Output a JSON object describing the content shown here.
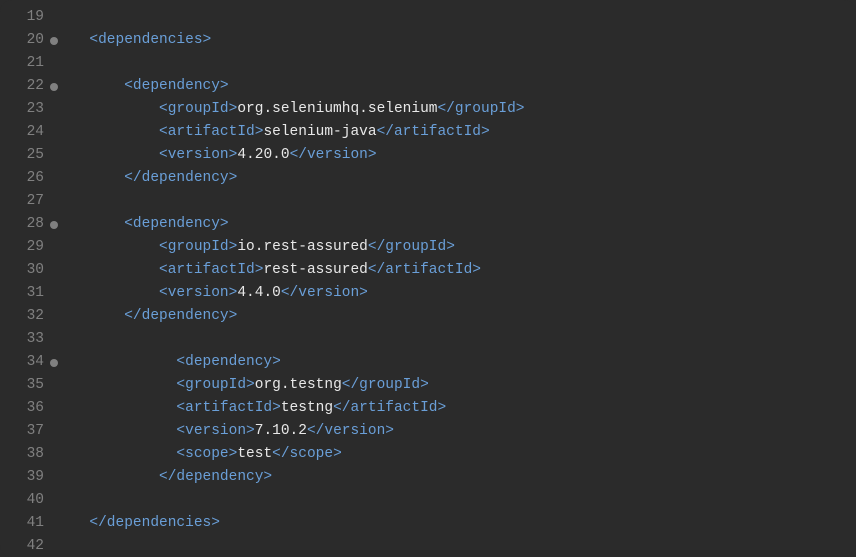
{
  "lines": [
    {
      "num": "19",
      "fold": false,
      "indent": "",
      "segments": []
    },
    {
      "num": "20",
      "fold": true,
      "indent": "  ",
      "segments": [
        {
          "t": "tag",
          "v": "<dependencies>"
        }
      ]
    },
    {
      "num": "21",
      "fold": false,
      "indent": "",
      "segments": []
    },
    {
      "num": "22",
      "fold": true,
      "indent": "      ",
      "segments": [
        {
          "t": "tag",
          "v": "<dependency>"
        }
      ]
    },
    {
      "num": "23",
      "fold": false,
      "indent": "          ",
      "segments": [
        {
          "t": "tag",
          "v": "<groupId>"
        },
        {
          "t": "text",
          "v": "org.seleniumhq.selenium"
        },
        {
          "t": "tag",
          "v": "</groupId>"
        }
      ]
    },
    {
      "num": "24",
      "fold": false,
      "indent": "          ",
      "segments": [
        {
          "t": "tag",
          "v": "<artifactId>"
        },
        {
          "t": "text",
          "v": "selenium-java"
        },
        {
          "t": "tag",
          "v": "</artifactId>"
        }
      ]
    },
    {
      "num": "25",
      "fold": false,
      "indent": "          ",
      "segments": [
        {
          "t": "tag",
          "v": "<version>"
        },
        {
          "t": "text",
          "v": "4.20.0"
        },
        {
          "t": "tag",
          "v": "</version>"
        }
      ]
    },
    {
      "num": "26",
      "fold": false,
      "indent": "      ",
      "segments": [
        {
          "t": "tag",
          "v": "</dependency>"
        }
      ]
    },
    {
      "num": "27",
      "fold": false,
      "indent": "",
      "segments": []
    },
    {
      "num": "28",
      "fold": true,
      "indent": "      ",
      "segments": [
        {
          "t": "tag",
          "v": "<dependency>"
        }
      ]
    },
    {
      "num": "29",
      "fold": false,
      "indent": "          ",
      "segments": [
        {
          "t": "tag",
          "v": "<groupId>"
        },
        {
          "t": "text",
          "v": "io.rest-assured"
        },
        {
          "t": "tag",
          "v": "</groupId>"
        }
      ]
    },
    {
      "num": "30",
      "fold": false,
      "indent": "          ",
      "segments": [
        {
          "t": "tag",
          "v": "<artifactId>"
        },
        {
          "t": "text",
          "v": "rest-assured"
        },
        {
          "t": "tag",
          "v": "</artifactId>"
        }
      ]
    },
    {
      "num": "31",
      "fold": false,
      "indent": "          ",
      "segments": [
        {
          "t": "tag",
          "v": "<version>"
        },
        {
          "t": "text",
          "v": "4.4.0"
        },
        {
          "t": "tag",
          "v": "</version>"
        }
      ]
    },
    {
      "num": "32",
      "fold": false,
      "indent": "      ",
      "segments": [
        {
          "t": "tag",
          "v": "</dependency>"
        }
      ]
    },
    {
      "num": "33",
      "fold": false,
      "indent": "",
      "segments": []
    },
    {
      "num": "34",
      "fold": true,
      "indent": "            ",
      "segments": [
        {
          "t": "tag",
          "v": "<dependency>"
        }
      ]
    },
    {
      "num": "35",
      "fold": false,
      "indent": "            ",
      "segments": [
        {
          "t": "tag",
          "v": "<groupId>"
        },
        {
          "t": "text",
          "v": "org.testng"
        },
        {
          "t": "tag",
          "v": "</groupId>"
        }
      ]
    },
    {
      "num": "36",
      "fold": false,
      "indent": "            ",
      "segments": [
        {
          "t": "tag",
          "v": "<artifactId>"
        },
        {
          "t": "text",
          "v": "testng"
        },
        {
          "t": "tag",
          "v": "</artifactId>"
        }
      ]
    },
    {
      "num": "37",
      "fold": false,
      "indent": "            ",
      "segments": [
        {
          "t": "tag",
          "v": "<version>"
        },
        {
          "t": "text",
          "v": "7.10.2"
        },
        {
          "t": "tag",
          "v": "</version>"
        }
      ]
    },
    {
      "num": "38",
      "fold": false,
      "indent": "            ",
      "segments": [
        {
          "t": "tag",
          "v": "<scope>"
        },
        {
          "t": "text",
          "v": "test"
        },
        {
          "t": "tag",
          "v": "</scope>"
        }
      ]
    },
    {
      "num": "39",
      "fold": false,
      "indent": "          ",
      "segments": [
        {
          "t": "tag",
          "v": "</dependency>"
        }
      ]
    },
    {
      "num": "40",
      "fold": false,
      "indent": "",
      "segments": []
    },
    {
      "num": "41",
      "fold": false,
      "indent": "  ",
      "segments": [
        {
          "t": "tag",
          "v": "</dependencies>"
        }
      ]
    },
    {
      "num": "42",
      "fold": false,
      "indent": "",
      "segments": []
    }
  ]
}
